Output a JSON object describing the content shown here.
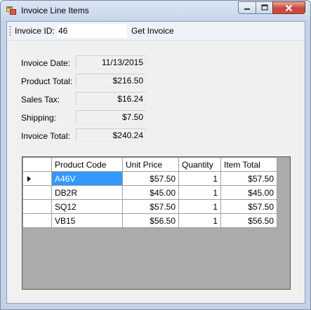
{
  "window": {
    "title": "Invoice Line Items"
  },
  "toolbar": {
    "invoice_id_label": "Invoice ID:",
    "invoice_id_value": "46",
    "get_invoice_label": "Get Invoice"
  },
  "fields": {
    "invoice_date": {
      "label": "Invoice Date:",
      "value": "11/13/2015"
    },
    "product_total": {
      "label": "Product Total:",
      "value": "$216.50"
    },
    "sales_tax": {
      "label": "Sales Tax:",
      "value": "$16.24"
    },
    "shipping": {
      "label": "Shipping:",
      "value": "$7.50"
    },
    "invoice_total": {
      "label": "Invoice Total:",
      "value": "$240.24"
    }
  },
  "grid": {
    "columns": [
      "Product Code",
      "Unit Price",
      "Quantity",
      "Item Total"
    ],
    "rows": [
      [
        "A46V",
        "$57.50",
        "1",
        "$57.50"
      ],
      [
        "DB2R",
        "$45.00",
        "1",
        "$45.00"
      ],
      [
        "SQ12",
        "$57.50",
        "1",
        "$57.50"
      ],
      [
        "VB15",
        "$56.50",
        "1",
        "$56.50"
      ]
    ]
  },
  "colors": {
    "selection": "#3399ff",
    "grid_background": "#ababab",
    "close_button": "#c7463a"
  }
}
